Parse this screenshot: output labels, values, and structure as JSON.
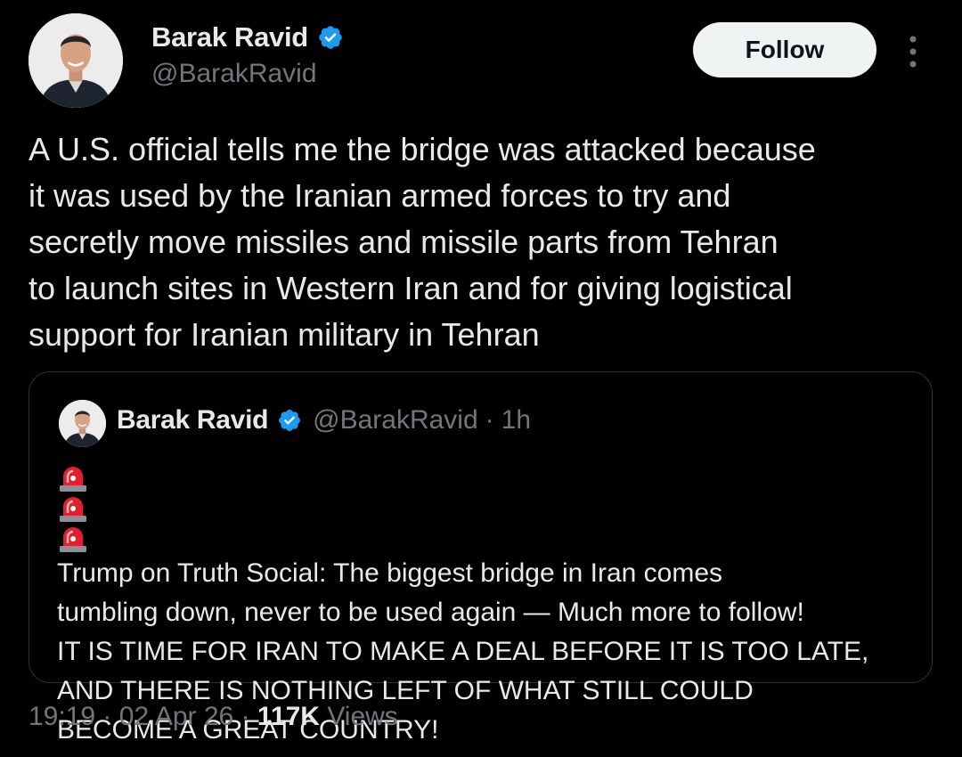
{
  "author": {
    "name": "Barak Ravid",
    "handle": "@BarakRavid",
    "verified": true
  },
  "follow_button": {
    "label": "Follow"
  },
  "more_button": {
    "icon": "more-vertical-icon"
  },
  "tweet": {
    "text_lines": [
      "A U.S. official tells me the bridge was attacked because",
      "it was used by the Iranian armed forces to try and",
      "secretly move missiles and missile parts from Tehran",
      "to launch sites in Western Iran and for giving logistical",
      "support for Iranian military in Tehran"
    ]
  },
  "quoted_tweet": {
    "author_name": "Barak Ravid",
    "handle": "@BarakRavid",
    "separator": "·",
    "time": "1h",
    "emoji_prefix": "🚨🚨🚨",
    "text_lines": [
      "Trump on Truth Social: The biggest bridge in Iran comes",
      "tumbling down, never to be used again — Much more to follow!",
      "IT IS TIME FOR IRAN TO MAKE A DEAL BEFORE IT IS TOO LATE,",
      "AND THERE IS NOTHING LEFT OF WHAT STILL COULD",
      "BECOME A GREAT COUNTRY!"
    ]
  },
  "meta": {
    "time": "19:19",
    "sep1": "·",
    "date": "02 Apr 26",
    "sep2": "·",
    "views_count": "117K",
    "views_label": "Views"
  },
  "colors": {
    "background": "#000000",
    "text_primary": "#e7e9ea",
    "text_secondary": "#71767b",
    "verified_blue": "#1d9bf0",
    "border": "#2f3336",
    "follow_bg": "#eff3f4"
  }
}
